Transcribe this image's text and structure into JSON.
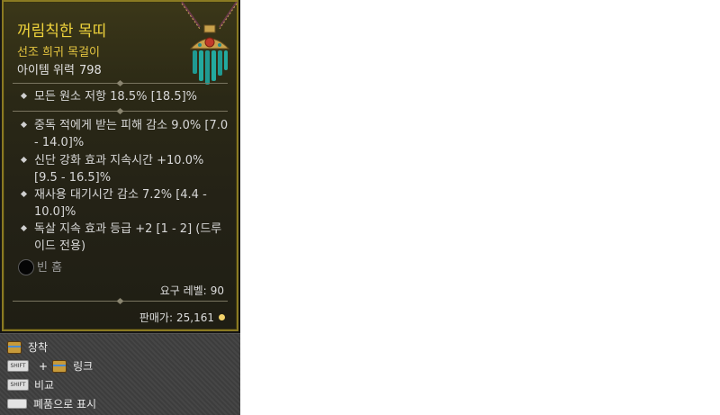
{
  "item": {
    "name": "꺼림칙한 목띠",
    "rarity": "선조 희귀 목걸이",
    "power_label": "아이템 위력",
    "power_value": "798"
  },
  "implicit": [
    "모든 원소 저항 18.5% [18.5]%"
  ],
  "affixes": [
    "중독 적에게 받는 피해 감소 9.0% [7.0 - 14.0]%",
    "신단 강화 효과 지속시간 +10.0% [9.5 - 16.5]%",
    "재사용 대기시간 감소 7.2% [4.4 - 10.0]%",
    "독살 지속 효과 등급 +2 [1 - 2] (드루이드 전용)"
  ],
  "socket": {
    "label": "빈 홈"
  },
  "requirement": {
    "label": "요구 레벨:",
    "value": "90"
  },
  "price": {
    "label": "판매가:",
    "value": "25,161"
  },
  "hints": {
    "equip": "장착",
    "link": "링크",
    "compare": "비교",
    "salvage": "폐품으로 표시",
    "shift_key": "SHIFT"
  },
  "colors": {
    "name": "#f0d43c",
    "rarity": "#e6c640",
    "border": "#8a7a22"
  },
  "icons": [
    "amulet-icon",
    "chest-icon",
    "shift-key-icon",
    "space-key-icon",
    "gold-coin-icon"
  ]
}
